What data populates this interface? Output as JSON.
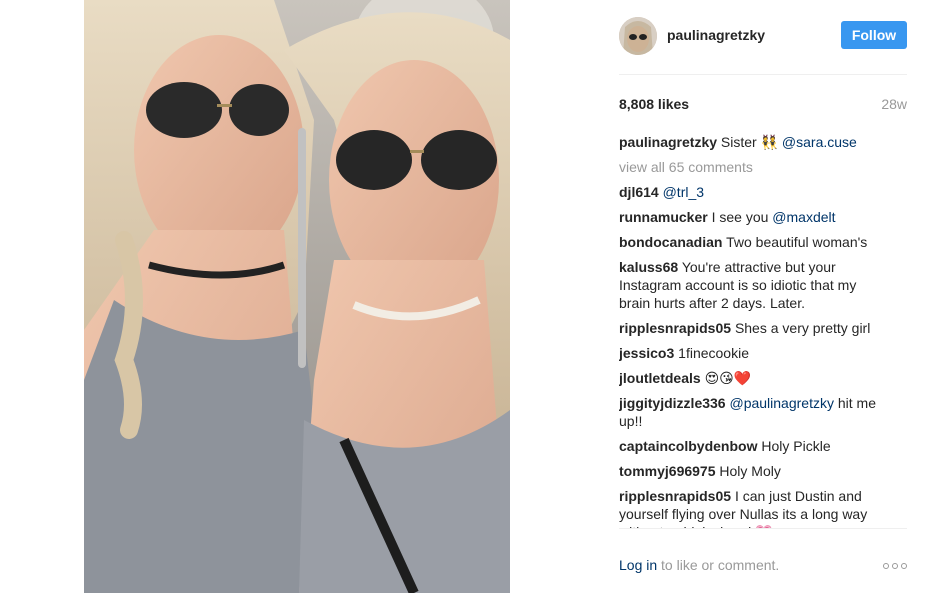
{
  "post": {
    "username": "paulinagretzky",
    "follow_label": "Follow",
    "likes": "8,808 likes",
    "age": "28w"
  },
  "caption": {
    "user": "paulinagretzky",
    "text": "Sister 👯",
    "mention": "@sara.cuse"
  },
  "view_all": "view all 65 comments",
  "comments": [
    {
      "user": "djl614",
      "mention": "@trl_3",
      "text": ""
    },
    {
      "user": "runnamucker",
      "text": "I see you ",
      "mention": "@maxdelt"
    },
    {
      "user": "bondocanadian",
      "text": "Two beautiful woman's"
    },
    {
      "user": "kaluss68",
      "text": "You're attractive but your Instagram account is so idiotic that my brain hurts after 2 days. Later."
    },
    {
      "user": "ripplesnrapids05",
      "text": "Shes a very pretty girl"
    },
    {
      "user": "jessico3",
      "text": "1finecookie"
    },
    {
      "user": "jloutletdeals",
      "text": "😍😘❤️"
    },
    {
      "user": "jiggityjdizzle336",
      "mention": "@paulinagretzky",
      "text": "hit me up!!"
    },
    {
      "user": "captaincolbydenbow",
      "text": "Holy Pickle"
    },
    {
      "user": "tommyj696975",
      "text": "Holy Moly"
    },
    {
      "user": "ripplesnrapids05",
      "text": "I can just Dustin and yourself flying over Nullas its a long way without a drinks break💗"
    }
  ],
  "footer": {
    "login_link": "Log in",
    "login_rest": " to like or comment."
  },
  "colors": {
    "accent": "#3897f0",
    "mention": "#003569",
    "muted": "#999999"
  },
  "icons": {
    "more": "more-options-icon"
  }
}
